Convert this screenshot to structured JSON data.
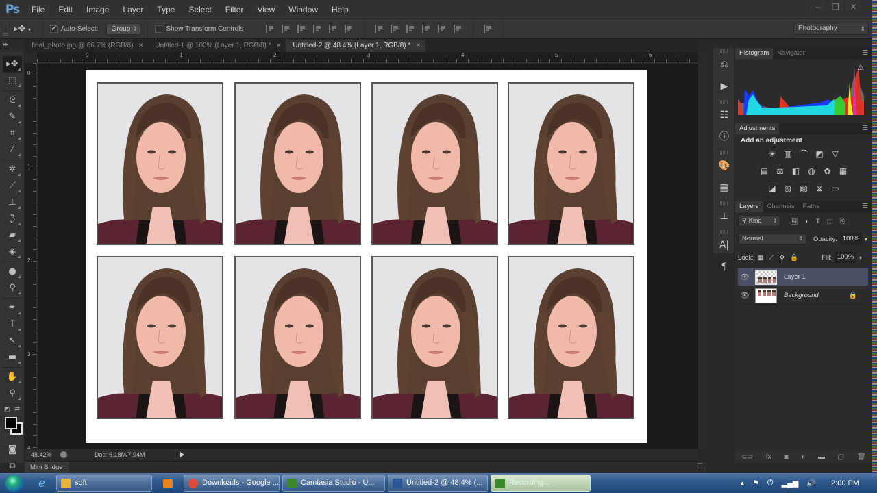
{
  "app": {
    "logo": "Ps"
  },
  "menu": [
    "File",
    "Edit",
    "Image",
    "Layer",
    "Type",
    "Select",
    "Filter",
    "View",
    "Window",
    "Help"
  ],
  "window_controls": {
    "minimize": "–",
    "restore": "❐",
    "close": "✕"
  },
  "options_bar": {
    "tool_icon": "move-tool",
    "auto_select_label": "Auto-Select:",
    "auto_select_checked": true,
    "auto_select_mode": "Group",
    "show_transform_label": "Show Transform Controls",
    "show_transform_checked": false,
    "workspace": "Photography"
  },
  "tabs": [
    {
      "label": "final_photo.jpg @ 66.7% (RGB/8)",
      "close": "×",
      "active": false
    },
    {
      "label": "Untitled-1 @ 100% (Layer 1, RGB/8) *",
      "close": "×",
      "active": false
    },
    {
      "label": "Untitled-2 @ 48.4% (Layer 1, RGB/8) *",
      "close": "×",
      "active": true
    }
  ],
  "tools": [
    {
      "name": "move-tool",
      "glyph": "▸✥",
      "selected": true
    },
    {
      "name": "marquee-tool",
      "glyph": "⬚"
    },
    {
      "name": "lasso-tool",
      "glyph": "ᘓ"
    },
    {
      "name": "quick-selection-tool",
      "glyph": "✎"
    },
    {
      "name": "crop-tool",
      "glyph": "⌗"
    },
    {
      "name": "eyedropper-tool",
      "glyph": "⁄"
    },
    {
      "name": "healing-brush-tool",
      "glyph": "✲"
    },
    {
      "name": "brush-tool",
      "glyph": "⟋"
    },
    {
      "name": "clone-stamp-tool",
      "glyph": "⊥"
    },
    {
      "name": "history-brush-tool",
      "glyph": "ℨ"
    },
    {
      "name": "eraser-tool",
      "glyph": "▰"
    },
    {
      "name": "paint-bucket-tool",
      "glyph": "◈"
    },
    {
      "name": "blur-tool",
      "glyph": "●"
    },
    {
      "name": "dodge-tool",
      "glyph": "⚲"
    },
    {
      "name": "pen-tool",
      "glyph": "✒"
    },
    {
      "name": "type-tool",
      "glyph": "T"
    },
    {
      "name": "path-selection-tool",
      "glyph": "↖"
    },
    {
      "name": "rectangle-tool",
      "glyph": "▬"
    },
    {
      "name": "hand-tool",
      "glyph": "✋"
    },
    {
      "name": "zoom-tool",
      "glyph": "⚲"
    }
  ],
  "rulers": {
    "horizontal": [
      "0",
      "1",
      "2",
      "3",
      "4",
      "5",
      "6"
    ],
    "vertical": [
      "0",
      "1",
      "2",
      "3",
      "4"
    ]
  },
  "document": {
    "photo_count": 8,
    "rows": 2,
    "cols": 4
  },
  "status": {
    "zoom": "48.42%",
    "doc_size": "Doc: 6.18M/7.94M"
  },
  "mini_bridge": {
    "label": "Mini Bridge"
  },
  "dock_icons": [
    "history-icon",
    "actions-play-icon",
    "properties-icon",
    "info-icon",
    "color-palette-icon",
    "swatches-icon",
    "clone-source-icon",
    "character-icon",
    "paragraph-icon"
  ],
  "histogram_panel": {
    "tabs": [
      "Histogram",
      "Navigator"
    ],
    "active": "Histogram",
    "warning": "⚠"
  },
  "adjustments_panel": {
    "tab": "Adjustments",
    "title": "Add an adjustment",
    "rows": [
      [
        "brightness-contrast",
        "levels",
        "curves",
        "exposure",
        "vibrance"
      ],
      [
        "hue-saturation",
        "color-balance",
        "black-white",
        "photo-filter",
        "channel-mixer",
        "color-lookup"
      ],
      [
        "invert",
        "posterize",
        "threshold",
        "selective-color",
        "gradient-map"
      ]
    ],
    "glyphs": [
      [
        "☀",
        "▥",
        "⌒",
        "◩",
        "▽"
      ],
      [
        "▤",
        "⚖",
        "◧",
        "◍",
        "✿",
        "▦"
      ],
      [
        "◪",
        "▨",
        "▧",
        "⊠",
        "▭"
      ]
    ]
  },
  "layers_panel": {
    "tabs": [
      "Layers",
      "Channels",
      "Paths"
    ],
    "active": "Layers",
    "filter_kind": "Kind",
    "filter_icons": [
      "🖼",
      "◐",
      "T",
      "⬚",
      "⎘"
    ],
    "blend_mode": "Normal",
    "opacity_label": "Opacity:",
    "opacity": "100%",
    "lock_label": "Lock:",
    "fill_label": "Fill:",
    "fill": "100%",
    "layers": [
      {
        "name": "Layer 1",
        "selected": true,
        "visible": true,
        "locked": false,
        "italic": false
      },
      {
        "name": "Background",
        "selected": false,
        "visible": true,
        "locked": true,
        "italic": true
      }
    ],
    "footer_icons": [
      "⊂⊃",
      "fx",
      "◙",
      "◐",
      "▬",
      "◳",
      "🗑"
    ]
  },
  "taskbar": {
    "items": [
      {
        "label": "soft",
        "icon_color": "#e8b33a"
      },
      {
        "label": "Downloads - Google ...",
        "icon_color": "#dd4b39"
      },
      {
        "label": "Camtasia Studio - U...",
        "icon_color": "#3a8a2c"
      },
      {
        "label": "Untitled-2 @ 48.4% (...",
        "icon_color": "#2b5797"
      },
      {
        "label": "Recording...",
        "icon_color": "#3a8a2c"
      }
    ],
    "clock": "2:00 PM"
  }
}
